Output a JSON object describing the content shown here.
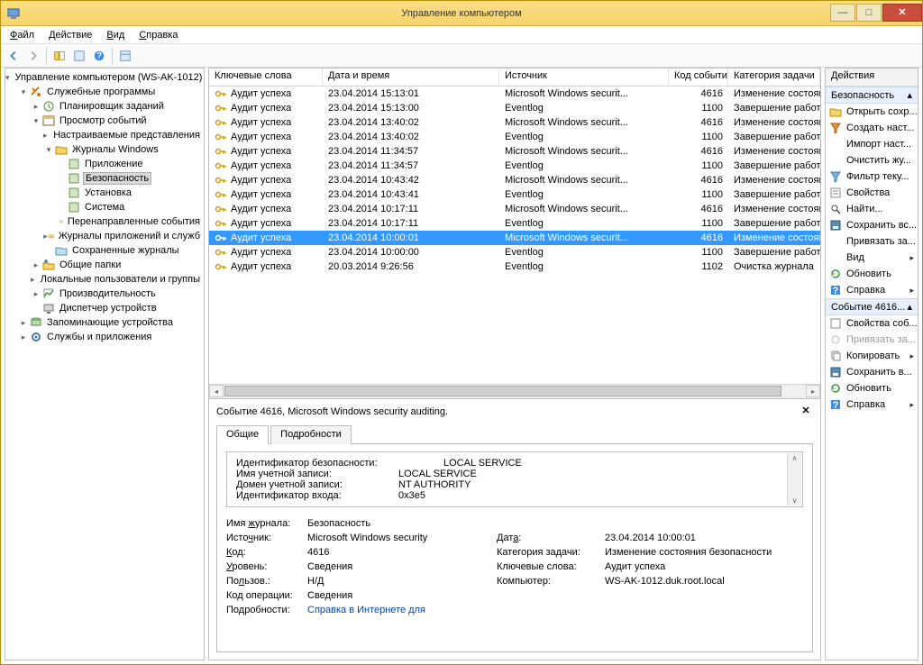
{
  "window": {
    "title": "Управление компьютером"
  },
  "titlebar_controls": {
    "min": "—",
    "max": "□",
    "close": "✕"
  },
  "menu": {
    "file": "Файл",
    "action": "Действие",
    "view": "Вид",
    "help": "Справка"
  },
  "tree": {
    "root": "Управление компьютером (WS-AK-1012)",
    "serv_prog": "Служебные программы",
    "task_sched": "Планировщик заданий",
    "event_viewer": "Просмотр событий",
    "custom_views": "Настраиваемые представления",
    "win_logs": "Журналы Windows",
    "app_log": "Приложение",
    "security_log": "Безопасность",
    "setup_log": "Установка",
    "system_log": "Система",
    "forwarded": "Перенаправленные события",
    "app_serv_logs": "Журналы приложений и служб",
    "saved_logs": "Сохраненные журналы",
    "shared_folders": "Общие папки",
    "local_users": "Локальные пользователи и группы",
    "performance": "Производительность",
    "dev_mgr": "Диспетчер устройств",
    "storage": "Запоминающие устройства",
    "services_apps": "Службы и приложения"
  },
  "columns": {
    "c1": "Ключевые слова",
    "c2": "Дата и время",
    "c3": "Источник",
    "c4": "Код события",
    "c5": "Категория задачи"
  },
  "events": [
    {
      "kw": "Аудит успеха",
      "dt": "23.04.2014 15:13:01",
      "src": "Microsoft Windows securit...",
      "id": "4616",
      "cat": "Изменение состояния с",
      "sel": false
    },
    {
      "kw": "Аудит успеха",
      "dt": "23.04.2014 15:13:00",
      "src": "Eventlog",
      "id": "1100",
      "cat": "Завершение работы сл",
      "sel": false
    },
    {
      "kw": "Аудит успеха",
      "dt": "23.04.2014 13:40:02",
      "src": "Microsoft Windows securit...",
      "id": "4616",
      "cat": "Изменение состояния с",
      "sel": false
    },
    {
      "kw": "Аудит успеха",
      "dt": "23.04.2014 13:40:02",
      "src": "Eventlog",
      "id": "1100",
      "cat": "Завершение работы сл",
      "sel": false
    },
    {
      "kw": "Аудит успеха",
      "dt": "23.04.2014 11:34:57",
      "src": "Microsoft Windows securit...",
      "id": "4616",
      "cat": "Изменение состояния с",
      "sel": false
    },
    {
      "kw": "Аудит успеха",
      "dt": "23.04.2014 11:34:57",
      "src": "Eventlog",
      "id": "1100",
      "cat": "Завершение работы сл",
      "sel": false
    },
    {
      "kw": "Аудит успеха",
      "dt": "23.04.2014 10:43:42",
      "src": "Microsoft Windows securit...",
      "id": "4616",
      "cat": "Изменение состояния с",
      "sel": false
    },
    {
      "kw": "Аудит успеха",
      "dt": "23.04.2014 10:43:41",
      "src": "Eventlog",
      "id": "1100",
      "cat": "Завершение работы сл",
      "sel": false
    },
    {
      "kw": "Аудит успеха",
      "dt": "23.04.2014 10:17:11",
      "src": "Microsoft Windows securit...",
      "id": "4616",
      "cat": "Изменение состояния с",
      "sel": false
    },
    {
      "kw": "Аудит успеха",
      "dt": "23.04.2014 10:17:11",
      "src": "Eventlog",
      "id": "1100",
      "cat": "Завершение работы сл",
      "sel": false
    },
    {
      "kw": "Аудит успеха",
      "dt": "23.04.2014 10:00:01",
      "src": "Microsoft Windows securit...",
      "id": "4616",
      "cat": "Изменение состояния с",
      "sel": true
    },
    {
      "kw": "Аудит успеха",
      "dt": "23.04.2014 10:00:00",
      "src": "Eventlog",
      "id": "1100",
      "cat": "Завершение работы сл",
      "sel": false
    },
    {
      "kw": "Аудит успеха",
      "dt": "20.03.2014 9:26:56",
      "src": "Eventlog",
      "id": "1102",
      "cat": "Очистка журнала",
      "sel": false
    }
  ],
  "detail": {
    "title": "Событие 4616, Microsoft Windows security auditing.",
    "tab_general": "Общие",
    "tab_details": "Подробности",
    "subject": {
      "sid_label": "Идентификатор безопасности:",
      "sid_value": "LOCAL SERVICE",
      "acct_label": "Имя учетной записи:",
      "acct_value": "LOCAL SERVICE",
      "domain_label": "Домен учетной записи:",
      "domain_value": "NT AUTHORITY",
      "logon_id_label": "Идентификатор входа:",
      "logon_id_value": "0x3e5"
    },
    "fields": {
      "log_name_l": "Имя журнала:",
      "log_name_v": "Безопасность",
      "source_l": "Источник:",
      "source_v": "Microsoft Windows security",
      "date_l": "Дата:",
      "date_v": "23.04.2014 10:00:01",
      "code_l": "Код:",
      "code_v": "4616",
      "task_cat_l": "Категория задачи:",
      "task_cat_v": "Изменение состояния безопасности",
      "level_l": "Уровень:",
      "level_v": "Сведения",
      "keywords_l": "Ключевые слова:",
      "keywords_v": "Аудит успеха",
      "user_l": "Пользов.:",
      "user_v": "Н/Д",
      "computer_l": "Компьютер:",
      "computer_v": "WS-AK-1012.duk.root.local",
      "opcode_l": "Код операции:",
      "opcode_v": "Сведения",
      "moreinfo_l": "Подробности:",
      "moreinfo_v": "Справка в Интернете для"
    }
  },
  "actions": {
    "header": "Действия",
    "sec_security": "Безопасность",
    "open_saved": "Открыть сохр...",
    "create_custom": "Создать наст...",
    "import_custom": "Импорт наст...",
    "clear_log": "Очистить жу...",
    "filter_current": "Фильтр теку...",
    "properties": "Свойства",
    "find": "Найти...",
    "save_all": "Сохранить вс...",
    "attach_task": "Привязать за...",
    "view": "Вид",
    "refresh": "Обновить",
    "help": "Справка",
    "sec_event": "Событие 4616...",
    "ev_props": "Свойства соб...",
    "ev_attach": "Привязать за...",
    "ev_copy": "Копировать",
    "ev_save": "Сохранить в...",
    "ev_refresh": "Обновить",
    "ev_help": "Справка"
  }
}
